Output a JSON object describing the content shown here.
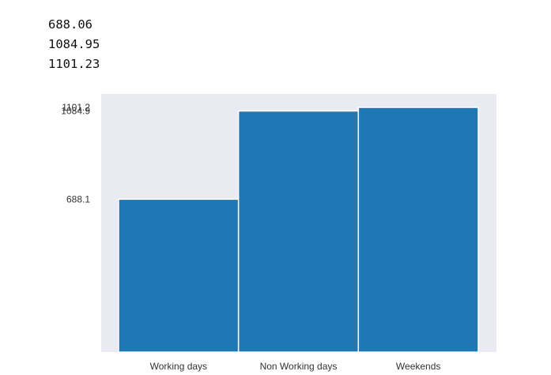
{
  "printed_output": [
    "688.06",
    "1084.95",
    "1101.23"
  ],
  "chart_data": {
    "type": "bar",
    "categories": [
      "Working days",
      "Non Working days",
      "Weekends"
    ],
    "values": [
      688.06,
      1084.95,
      1101.23
    ],
    "ytick_labels": [
      "688.1",
      "1084.9",
      "1101.2"
    ],
    "ylim": [
      0,
      1101.23
    ],
    "title": "",
    "xlabel": "",
    "ylabel": "",
    "grid": false,
    "colors": {
      "bar": "#1f77b4",
      "plot_background": "#eaeaf2",
      "bar_edge": "#ffffff"
    }
  }
}
